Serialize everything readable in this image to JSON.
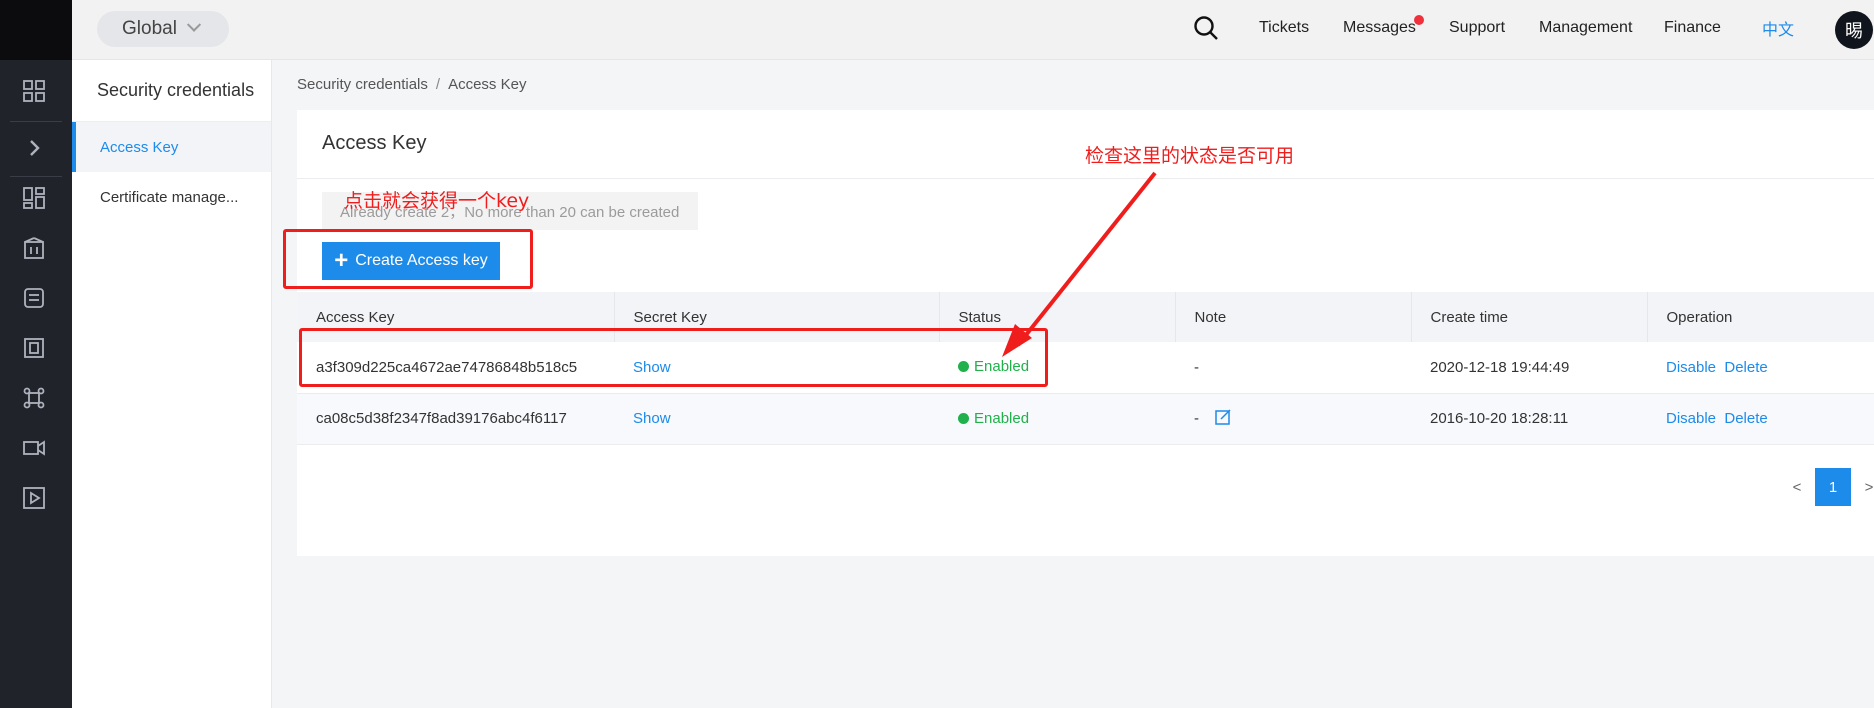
{
  "topbar": {
    "region": "Global",
    "nav": [
      "Tickets",
      "Messages",
      "Support",
      "Management",
      "Finance"
    ],
    "lang": "中文",
    "avatar": "晹"
  },
  "sidebar": {
    "title": "Security credentials",
    "items": [
      {
        "label": "Access Key",
        "active": true
      },
      {
        "label": "Certificate manage..."
      }
    ]
  },
  "breadcrumb": [
    "Security credentials",
    "Access Key"
  ],
  "card": {
    "title": "Access Key",
    "hint": "Already create 2，No more than 20 can be created",
    "create_label": "Create Access key"
  },
  "table": {
    "columns": [
      "Access Key",
      "Secret Key",
      "Status",
      "Note",
      "Create time",
      "Operation"
    ],
    "rows": [
      {
        "key": "a3f309d225ca4672ae74786848b518c5",
        "secret": "Show",
        "status": "Enabled",
        "note": "-",
        "time": "2020-12-18 19:44:49",
        "op1": "Disable",
        "op2": "Delete"
      },
      {
        "key": "ca08c5d38f2347f8ad39176abc4f6117",
        "secret": "Show",
        "status": "Enabled",
        "note": "-",
        "time": "2016-10-20 18:28:11",
        "op1": "Disable",
        "op2": "Delete"
      }
    ]
  },
  "pagination": {
    "prev": "<",
    "current": "1",
    "next": ">"
  },
  "annotations": {
    "click_hint": "点击就会获得一个key",
    "status_hint": "检查这里的状态是否可用"
  },
  "colors": {
    "accent": "#1d8bea",
    "enabled": "#21b04b",
    "annotation": "#f01d1d",
    "rail": "#21232b"
  }
}
